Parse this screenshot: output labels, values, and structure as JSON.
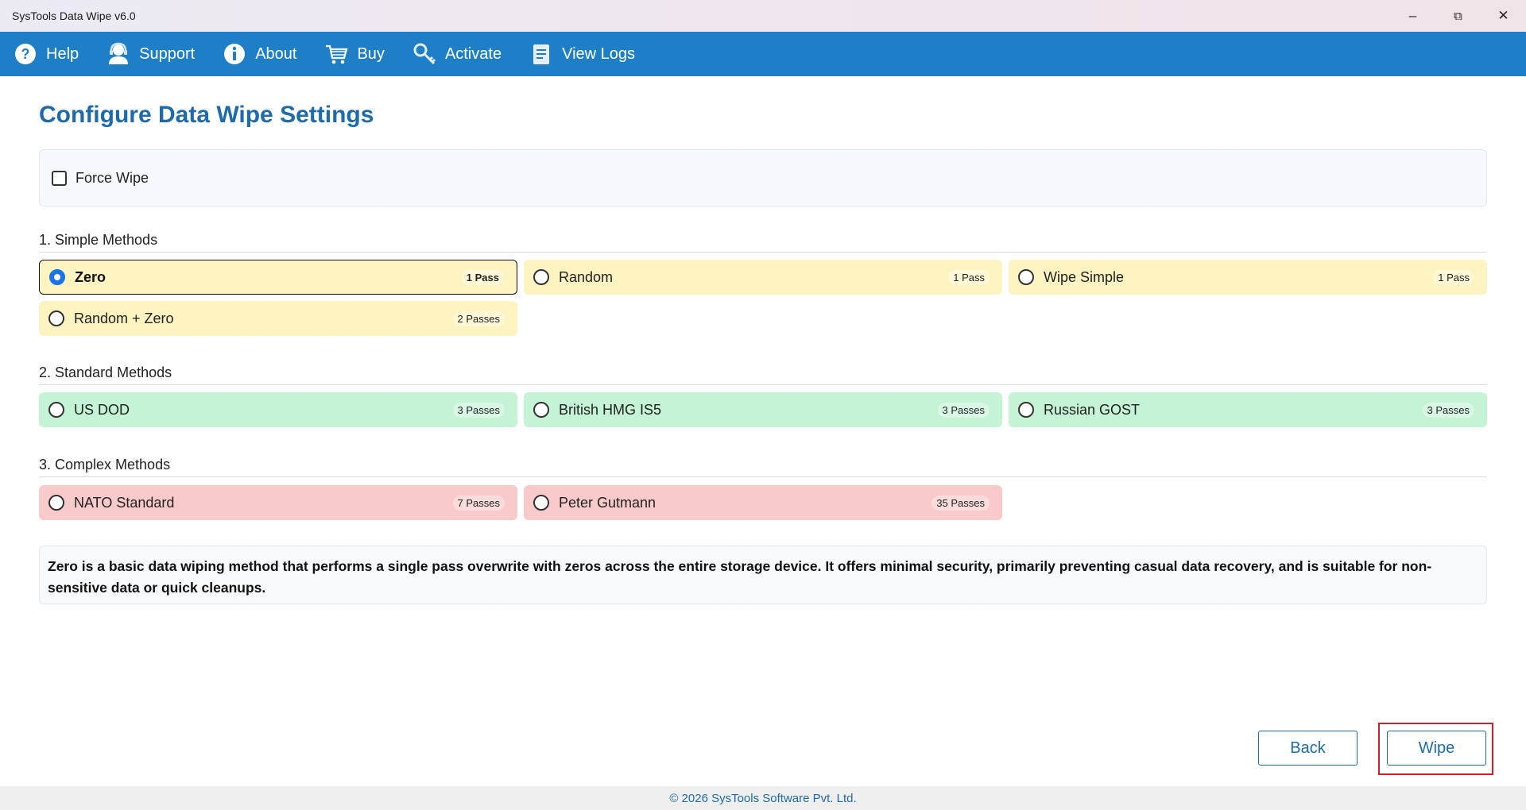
{
  "window": {
    "title": "SysTools Data Wipe v6.0",
    "controls": {
      "minimize": "–",
      "restore": "⧉",
      "close": "✕"
    }
  },
  "toolbar": {
    "items": [
      {
        "label": "Help",
        "icon": "help-icon"
      },
      {
        "label": "Support",
        "icon": "support-icon"
      },
      {
        "label": "About",
        "icon": "info-icon"
      },
      {
        "label": "Buy",
        "icon": "cart-icon"
      },
      {
        "label": "Activate",
        "icon": "key-icon"
      },
      {
        "label": "View Logs",
        "icon": "logs-icon"
      }
    ]
  },
  "page": {
    "title": "Configure Data Wipe Settings"
  },
  "force_wipe": {
    "label": "Force Wipe",
    "checked": false
  },
  "sections": {
    "simple": {
      "title": "1. Simple Methods",
      "options": [
        {
          "name": "Zero",
          "passes": "1 Pass",
          "selected": true
        },
        {
          "name": "Random",
          "passes": "1 Pass",
          "selected": false
        },
        {
          "name": "Wipe Simple",
          "passes": "1 Pass",
          "selected": false
        },
        {
          "name": "Random + Zero",
          "passes": "2 Passes",
          "selected": false
        }
      ]
    },
    "standard": {
      "title": "2. Standard Methods",
      "options": [
        {
          "name": "US DOD",
          "passes": "3 Passes",
          "selected": false
        },
        {
          "name": "British HMG IS5",
          "passes": "3 Passes",
          "selected": false
        },
        {
          "name": "Russian GOST",
          "passes": "3 Passes",
          "selected": false
        }
      ]
    },
    "complex": {
      "title": "3. Complex Methods",
      "options": [
        {
          "name": "NATO Standard",
          "passes": "7 Passes",
          "selected": false
        },
        {
          "name": "Peter Gutmann",
          "passes": "35 Passes",
          "selected": false
        }
      ]
    }
  },
  "description": "Zero is a basic data wiping method that performs a single pass overwrite with zeros across the entire storage device. It offers minimal security, primarily preventing casual data recovery, and is suitable for non-sensitive data or quick cleanups.",
  "buttons": {
    "back": "Back",
    "wipe": "Wipe"
  },
  "footer": {
    "copyright": "© 2026 SysTools Software Pvt. Ltd."
  },
  "colors": {
    "toolbar": "#1f7fc6",
    "accent": "#1f6aa8",
    "simple_bg": "#fdf4c2",
    "standard_bg": "#c4f3d6",
    "complex_bg": "#f9caca",
    "highlight": "#d32027"
  }
}
